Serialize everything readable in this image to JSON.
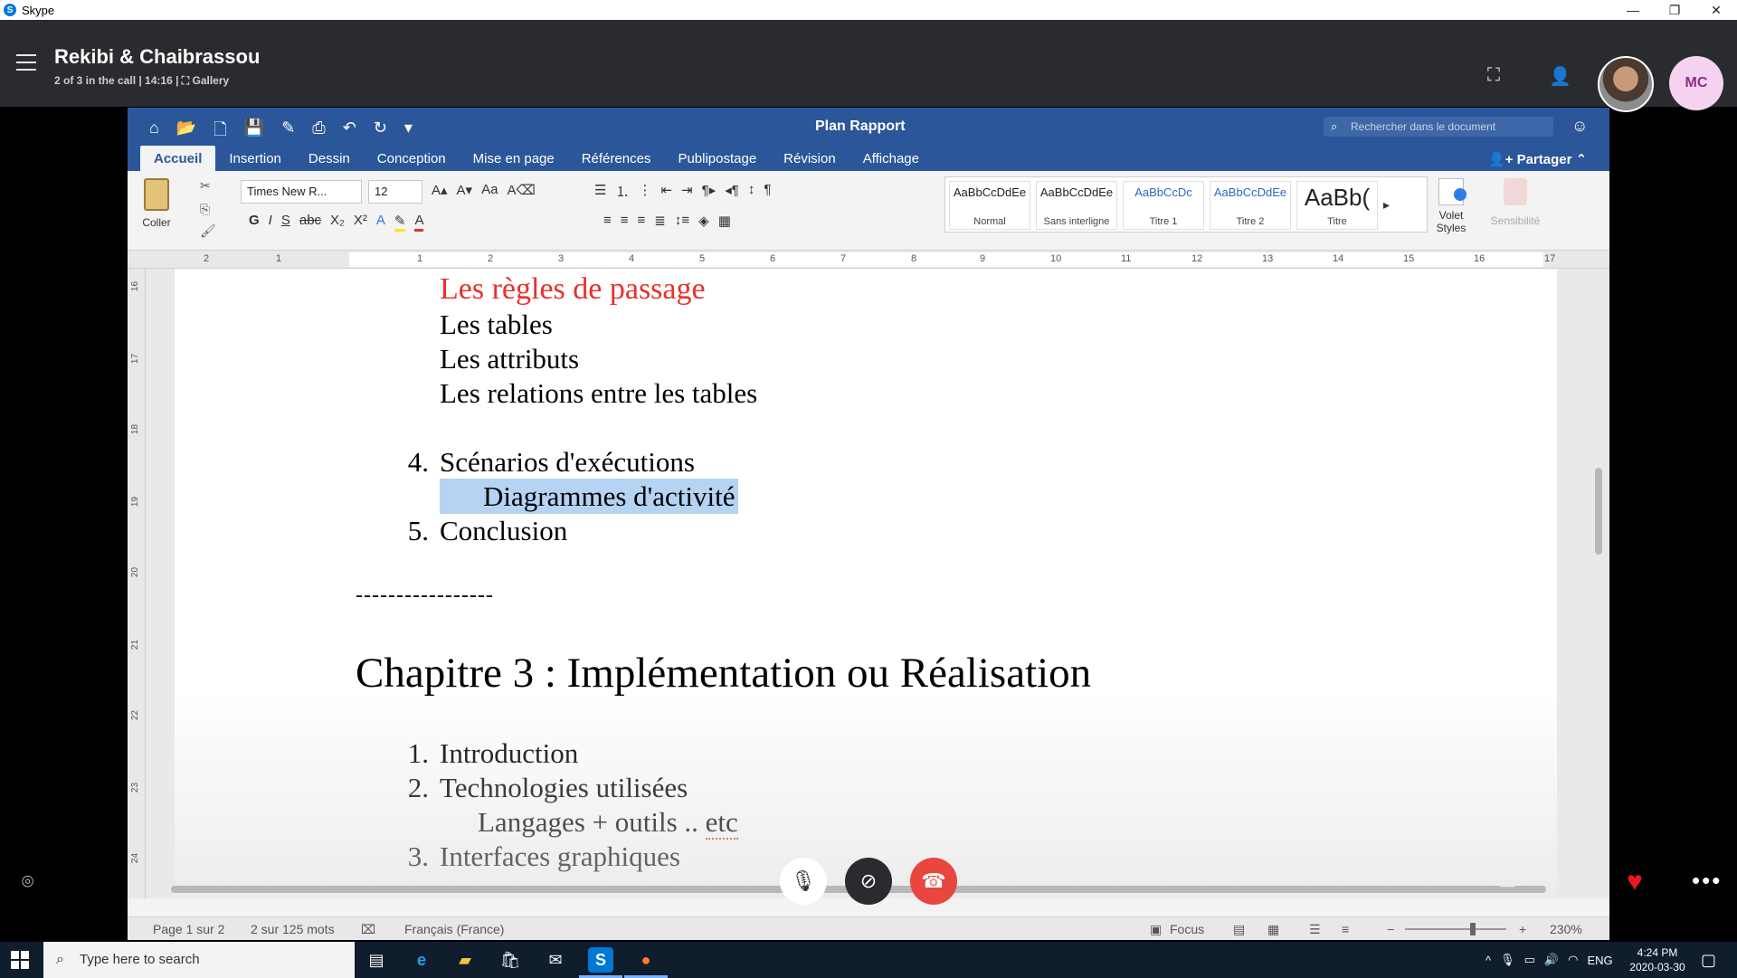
{
  "window": {
    "app_name": "Skype",
    "min": "—",
    "restore": "❐",
    "close": "✕"
  },
  "call": {
    "title": "Rekibi & Chaibrassou",
    "subtitle": "2 of 3 in the call | 14:16 | ⛶ Gallery",
    "participant_initials": "MC"
  },
  "word": {
    "doc_title": "Plan Rapport",
    "search_placeholder": "Rechercher dans le document",
    "tabs": [
      "Accueil",
      "Insertion",
      "Dessin",
      "Conception",
      "Mise en page",
      "Références",
      "Publipostage",
      "Révision",
      "Affichage"
    ],
    "share_label": "Partager",
    "paste_label": "Coller",
    "font_name": "Times New R...",
    "font_size": "12",
    "styles": [
      {
        "sample": "AaBbCcDdEe",
        "name": "Normal"
      },
      {
        "sample": "AaBbCcDdEe",
        "name": "Sans interligne"
      },
      {
        "sample": "AaBbCcDc",
        "name": "Titre 1"
      },
      {
        "sample": "AaBbCcDdEe",
        "name": "Titre 2"
      },
      {
        "sample": "AaBb(",
        "name": "Titre"
      }
    ],
    "volet_styles_label": "Volet Styles",
    "sensibilite_label": "Sensibilité",
    "ruler_ticks": [
      "2",
      "1",
      "1",
      "2",
      "3",
      "4",
      "5",
      "6",
      "7",
      "8",
      "9",
      "10",
      "11",
      "12",
      "13",
      "14",
      "15",
      "16",
      "17"
    ],
    "vruler_ticks": [
      "16",
      "17",
      "18",
      "19",
      "20",
      "21",
      "22",
      "23",
      "24"
    ],
    "document": {
      "line_regles": "Les règles de passage",
      "line_tables": "Les tables",
      "line_attributs": "Les attributs",
      "line_relations": "Les relations entre les tables",
      "item4_num": "4.",
      "item4_text": "Scénarios d'exécutions",
      "line_diagrammes": "Diagrammes d'activité",
      "item5_num": "5.",
      "item5_text": "Conclusion",
      "separator": "-----------------",
      "chapter_title": "Chapitre 3 : Implémentation ou Réalisation",
      "c1_num": "1.",
      "c1_text": "Introduction",
      "c2_num": "2.",
      "c2_text": "Technologies utilisées",
      "line_langages_pre": "Langages + outils .. ",
      "line_langages_etc": "etc",
      "c3_num": "3.",
      "c3_text": "Interfaces graphiques"
    },
    "status": {
      "page": "Page 1 sur 2",
      "words": "2 sur 125 mots",
      "language": "Français (France)",
      "focus": "Focus",
      "zoom": "230%"
    }
  },
  "taskbar": {
    "search_placeholder": "Type here to search",
    "language": "ENG",
    "time": "4:24 PM",
    "date": "2020-03-30"
  }
}
